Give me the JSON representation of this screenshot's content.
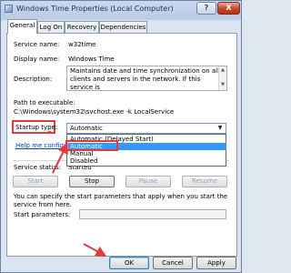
{
  "window": {
    "title": "Windows Time Properties (Local Computer)",
    "help_label": "?",
    "close_label": "X"
  },
  "tabs": [
    {
      "label": "General"
    },
    {
      "label": "Log On"
    },
    {
      "label": "Recovery"
    },
    {
      "label": "Dependencies"
    }
  ],
  "general": {
    "service_name_label": "Service name:",
    "service_name_value": "w32time",
    "display_name_label": "Display name:",
    "display_name_value": "Windows Time",
    "description_label": "Description:",
    "description_text": "Maintains date and time synchronization on all clients and servers in the network. If this service is",
    "path_label": "Path to executable:",
    "path_value": "C:\\Windows\\system32\\svchost.exe -k LocalService",
    "startup_type_label": "Startup typ̲e:",
    "startup_selected": "Automatic",
    "startup_options": [
      "Automatic (Delayed Start)",
      "Automatic",
      "Manual",
      "Disabled"
    ],
    "help_link": "Help me configure",
    "service_status_label": "Service status:",
    "service_status_value": "Started",
    "buttons": {
      "start": "Start",
      "stop": "Stop",
      "pause": "Pause",
      "resume": "Resume"
    },
    "start_params_text": "You can specify the start parameters that apply when you start the service from here.",
    "start_params_label": "Start parameters:"
  },
  "dialog_buttons": {
    "ok": "OK",
    "cancel": "Cancel",
    "apply": "Apply"
  },
  "annotation_color": "#e43a3a"
}
